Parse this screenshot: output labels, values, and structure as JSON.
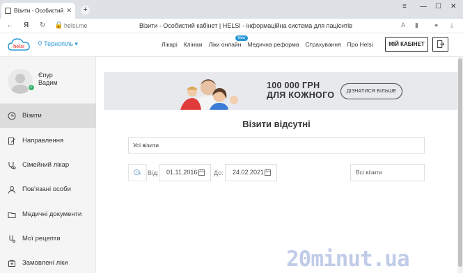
{
  "browser": {
    "tab_title": "Візити - Особистий кабінет | HELSI",
    "url": "helsi.me",
    "page_title": "Візити - Особистий кабінет | HELSI - інформаційна система для пацієнтів"
  },
  "header": {
    "city": "Тернопіль",
    "nav": [
      {
        "label": "Лікарі"
      },
      {
        "label": "Клініки"
      },
      {
        "label": "Ліки онлайн",
        "badge": "New"
      },
      {
        "label": "Медична реформа"
      },
      {
        "label": "Страхування"
      },
      {
        "label": "Про Helsi"
      }
    ],
    "cabinet_label": "МІЙ КАБІНЕТ"
  },
  "profile": {
    "first": "Єпур",
    "last": "Вадим"
  },
  "sidebar": {
    "items": [
      {
        "label": "Візити",
        "icon": "clock-icon",
        "active": true
      },
      {
        "label": "Направлення",
        "icon": "document-edit-icon"
      },
      {
        "label": "Сімейний лікар",
        "icon": "stethoscope-icon"
      },
      {
        "label": "Пов'язані особи",
        "icon": "person-icon"
      },
      {
        "label": "Медичні документи",
        "icon": "folder-icon"
      },
      {
        "label": "Мої рецепти",
        "icon": "prescription-icon"
      },
      {
        "label": "Замовлені ліки",
        "icon": "pharmacy-icon"
      }
    ]
  },
  "banner": {
    "title_line1": "100 000 ГРН",
    "title_line2": "ДЛЯ КОЖНОГО",
    "button": "ДІЗНАТИСЯ БІЛЬШЕ"
  },
  "main": {
    "empty_title": "Візити відсутні",
    "visit_filter": "Усі візити",
    "from_label": "Від:",
    "from_date": "01.11.2016",
    "to_label": "До:",
    "to_date": "24.02.2021",
    "type_filter": "Всі візити"
  },
  "watermark": "20minut.ua"
}
